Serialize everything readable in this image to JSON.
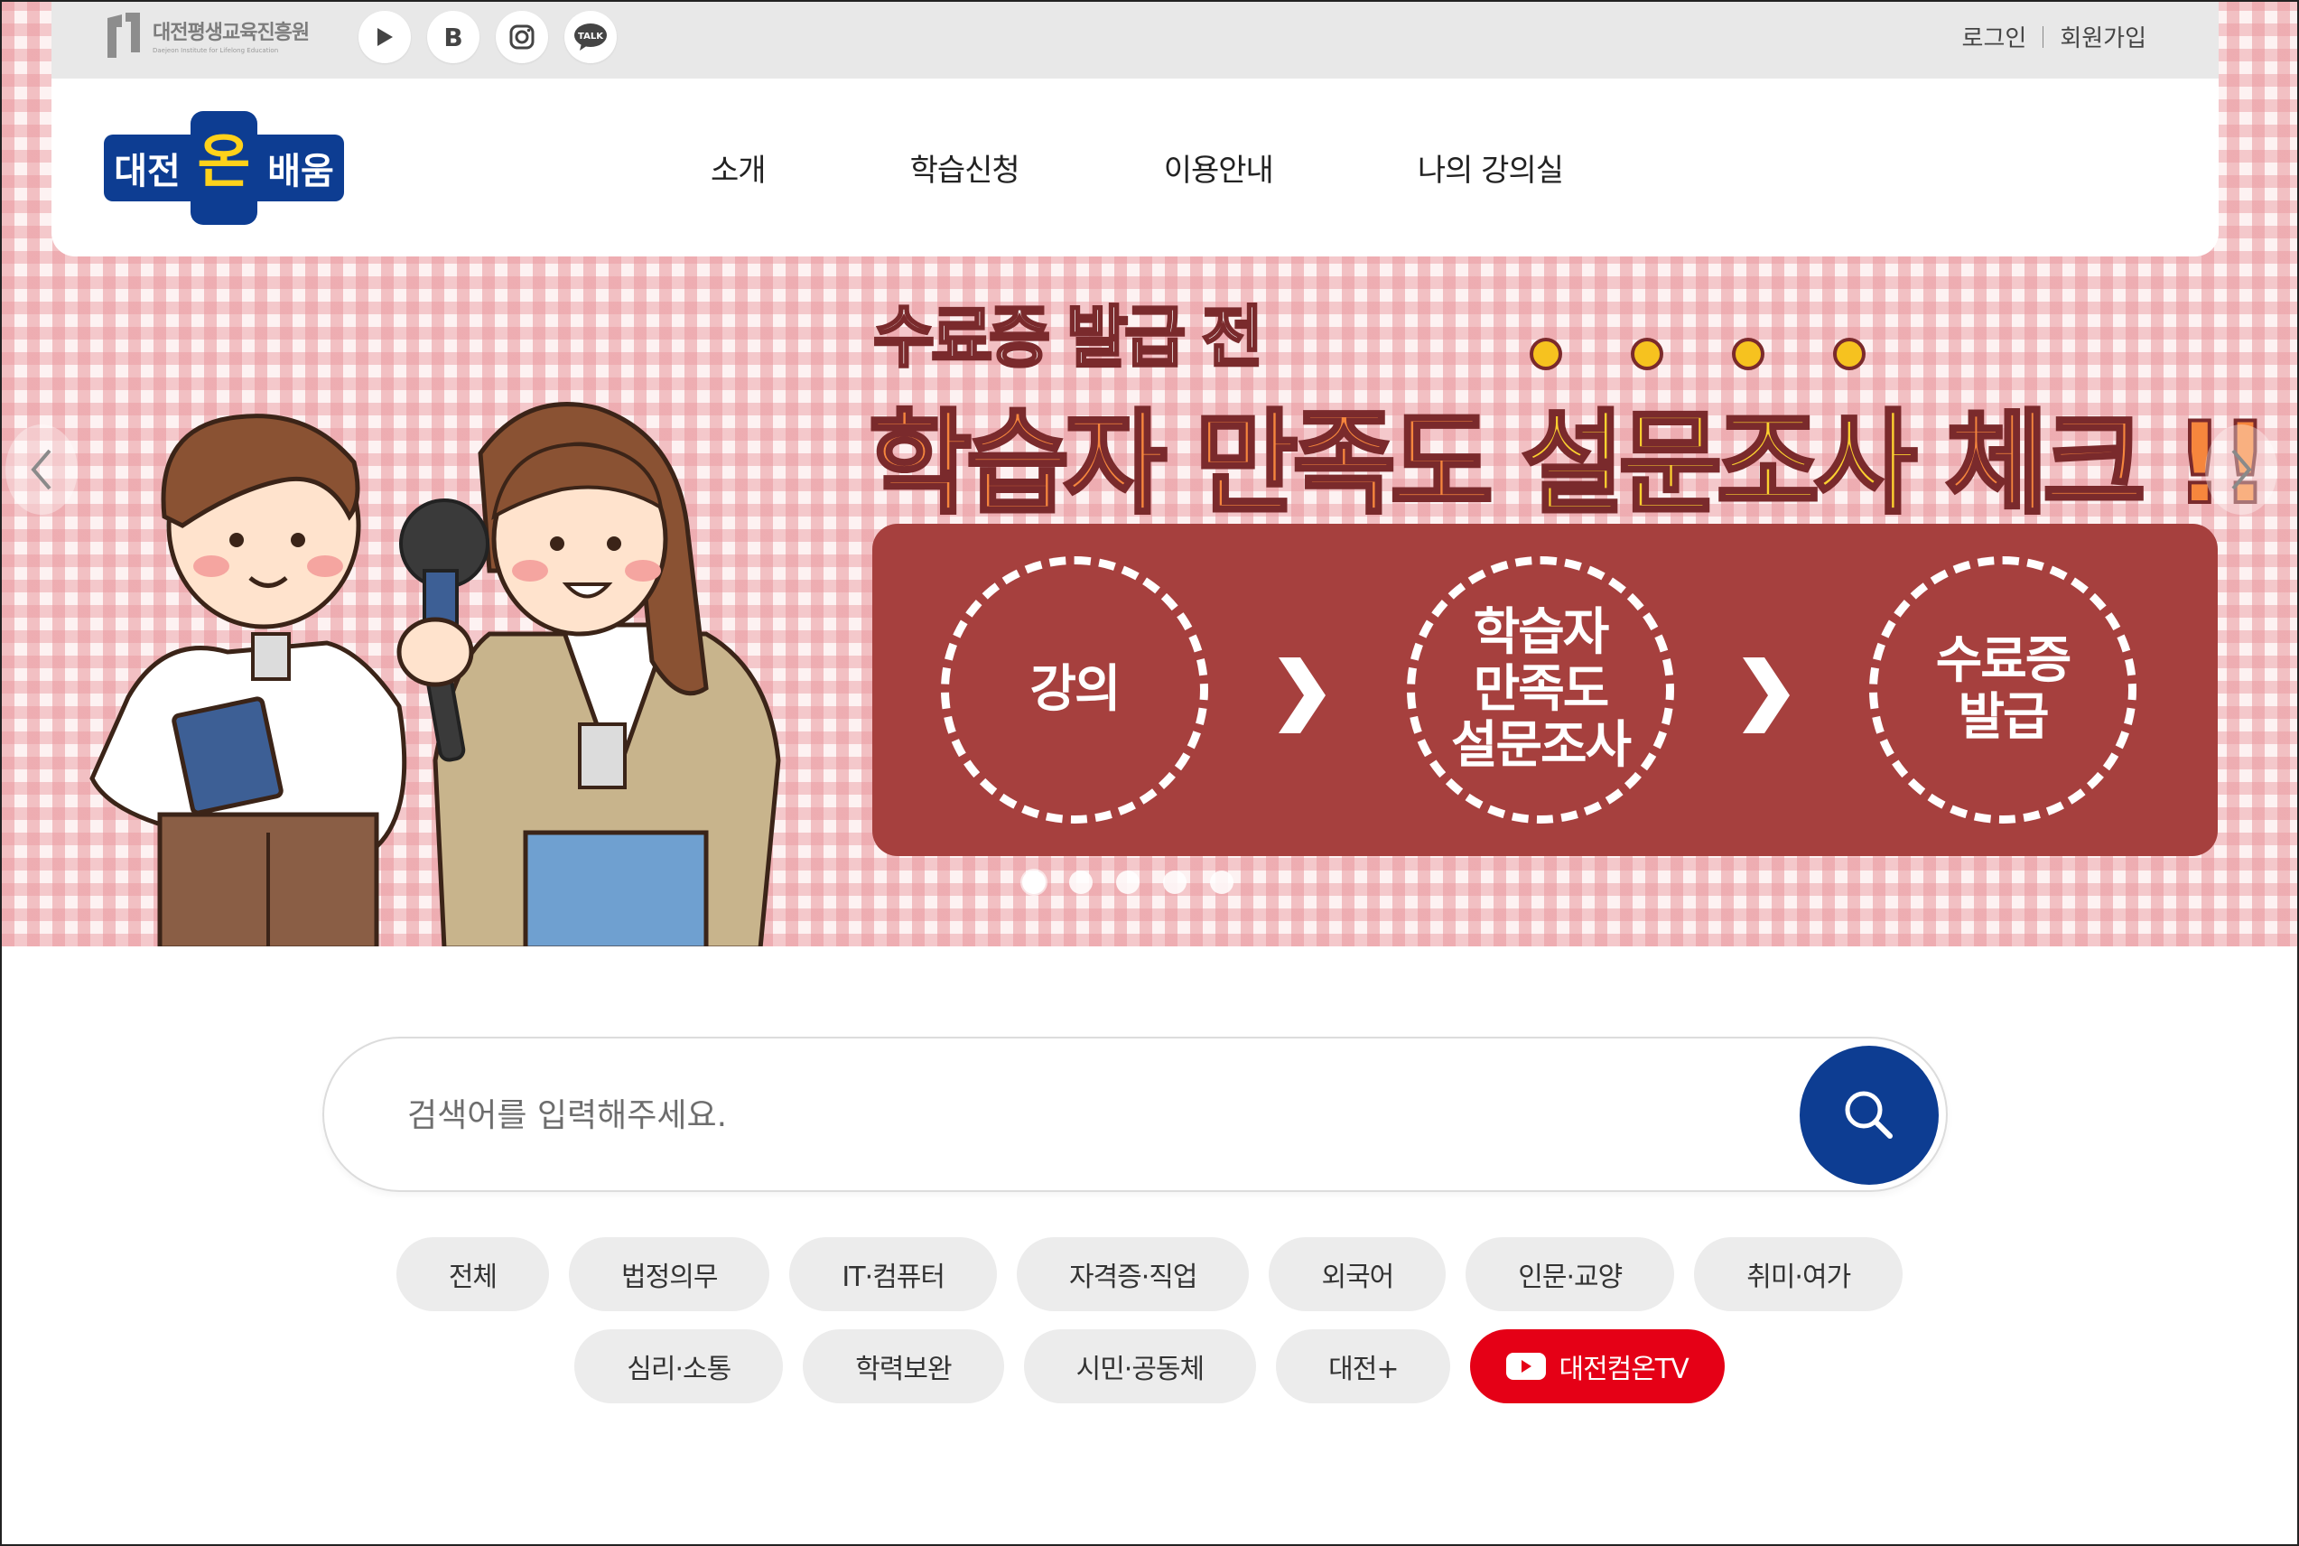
{
  "topbar": {
    "org_name": "대전평생교육진흥원",
    "org_name_en": "Daejeon Institute for Lifelong Education",
    "sns": [
      {
        "icon": "youtube-play-icon"
      },
      {
        "icon": "blog-icon",
        "label": "B"
      },
      {
        "icon": "instagram-icon"
      },
      {
        "icon": "kakaotalk-icon",
        "label": "TALK"
      }
    ],
    "login": "로그인",
    "signup": "회원가입"
  },
  "header": {
    "logo_text": "대전온배움",
    "nav": [
      "소개",
      "학습신청",
      "이용안내",
      "나의 강의실"
    ]
  },
  "banner": {
    "sub_title": "수료증 발급 전",
    "title_part1": "학습자 만족도 ",
    "title_highlight": "설문조사",
    "title_part2": " 체크 !!",
    "steps": [
      {
        "lines": "강의"
      },
      {
        "lines": "학습자 만족도 설문조사"
      },
      {
        "lines": "수료증 발급"
      }
    ],
    "slide_count": 5,
    "active_slide": 1
  },
  "search": {
    "placeholder": "검색어를 입력해주세요."
  },
  "categories": {
    "row1": [
      "전체",
      "법정의무",
      "IT·컴퓨터",
      "자격증·직업",
      "외국어",
      "인문·교양",
      "취미·여가"
    ],
    "row2": [
      "심리·소통",
      "학력보완",
      "시민·공동체",
      "대전+"
    ],
    "tv_label": "대전컴온TV"
  },
  "colors": {
    "brand_navy": "#0d3d92",
    "banner_red": "#a6403e",
    "highlight_yellow": "#fcd12f",
    "headline_orange": "#f6863d",
    "tv_red": "#e50016"
  }
}
